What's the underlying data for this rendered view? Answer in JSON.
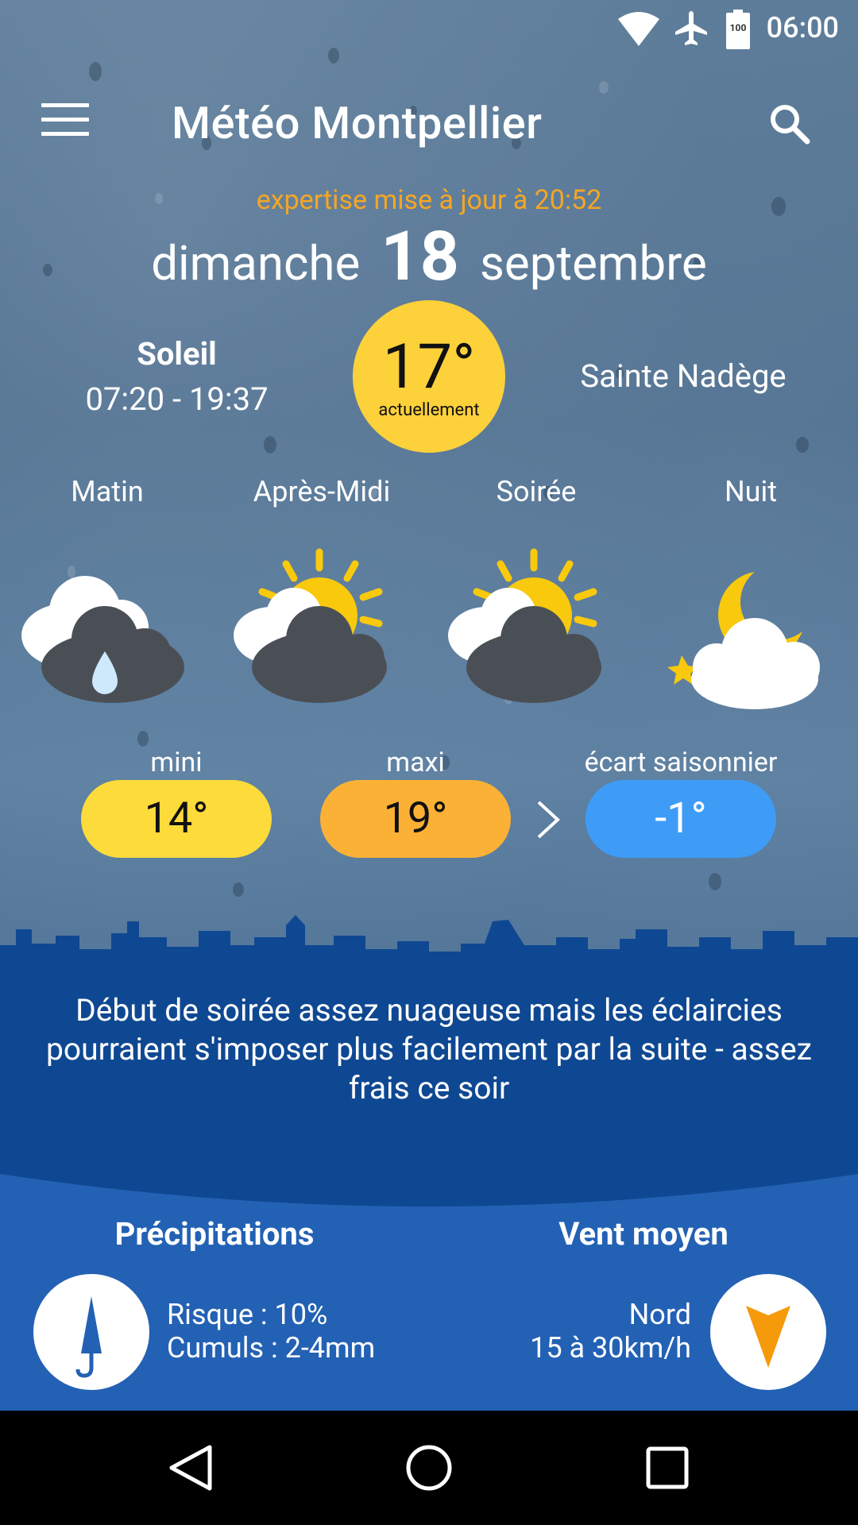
{
  "status_bar": {
    "time": "06:00",
    "battery_text": "100",
    "icons": [
      "wifi-icon",
      "airplane-icon",
      "battery-icon"
    ]
  },
  "app_bar": {
    "title": "Météo Montpellier",
    "menu_icon": "hamburger-menu-icon",
    "search_icon": "search-icon"
  },
  "updated": "expertise mise à jour à 20:52",
  "date": {
    "weekday": "dimanche",
    "day": "18",
    "month": "septembre"
  },
  "sun": {
    "title": "Soleil",
    "times": "07:20 - 19:37"
  },
  "current": {
    "temp": "17°",
    "label": "actuellement"
  },
  "saint": "Sainte Nadège",
  "periods": [
    {
      "label": "Matin",
      "icon": "rain-cloud-icon"
    },
    {
      "label": "Après-Midi",
      "icon": "sun-cloud-icon"
    },
    {
      "label": "Soirée",
      "icon": "sun-cloud-icon"
    },
    {
      "label": "Nuit",
      "icon": "moon-cloud-icon"
    }
  ],
  "temps": {
    "min_label": "mini",
    "min_value": "14°",
    "max_label": "maxi",
    "max_value": "19°",
    "ecart_label": "écart saisonnier",
    "ecart_value": "-1°"
  },
  "forecast_text": "Début de soirée assez nuageuse mais les éclaircies pourraient s'imposer plus facilement par la suite - assez frais ce soir",
  "precipitations": {
    "title": "Précipitations",
    "risk": "Risque : 10%",
    "cumul": "Cumuls : 2-4mm",
    "icon": "umbrella-icon"
  },
  "wind": {
    "title": "Vent moyen",
    "direction": "Nord",
    "speed": "15 à 30km/h",
    "icon": "wind-arrow-icon"
  },
  "colors": {
    "accent_orange": "#f5a623",
    "current_yellow": "#fdd13a",
    "min_yellow": "#fddb3a",
    "max_orange": "#fbb135",
    "ecart_blue": "#3e9cf6",
    "band_dark_blue": "#0f4892",
    "panel_blue": "#2361b4"
  }
}
